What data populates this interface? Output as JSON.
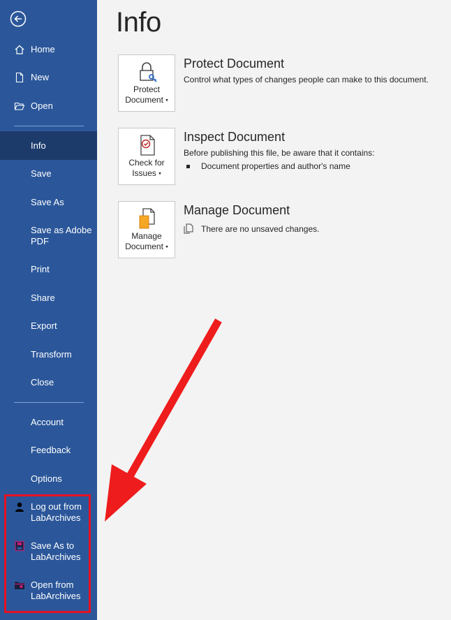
{
  "sidebar": {
    "back_icon": "back-arrow-icon",
    "top_items": [
      {
        "label": "Home",
        "icon": "home-icon"
      },
      {
        "label": "New",
        "icon": "new-document-icon"
      },
      {
        "label": "Open",
        "icon": "open-folder-icon"
      }
    ],
    "middle_items": [
      {
        "label": "Info",
        "active": true
      },
      {
        "label": "Save"
      },
      {
        "label": "Save As"
      },
      {
        "label": "Save as Adobe PDF"
      },
      {
        "label": "Print"
      },
      {
        "label": "Share"
      },
      {
        "label": "Export"
      },
      {
        "label": "Transform"
      },
      {
        "label": "Close"
      }
    ],
    "bottom_items": [
      {
        "label": "Account"
      },
      {
        "label": "Feedback"
      },
      {
        "label": "Options"
      }
    ],
    "labarchives_items": [
      {
        "label": "Log out from LabArchives",
        "icon": "user-icon"
      },
      {
        "label": "Save As to LabArchives",
        "icon": "save-labarchives-icon"
      },
      {
        "label": "Open from LabArchives",
        "icon": "open-labarchives-folder-icon"
      }
    ]
  },
  "main": {
    "title": "Info",
    "sections": [
      {
        "button_label": "Protect Document",
        "button_icon": "lock-key-icon",
        "title": "Protect Document",
        "description": "Control what types of changes people can make to this document."
      },
      {
        "button_label": "Check for Issues",
        "button_icon": "inspect-document-icon",
        "title": "Inspect Document",
        "description": "Before publishing this file, be aware that it contains:",
        "bullets": [
          "Document properties and author's name"
        ]
      },
      {
        "button_label": "Manage Document",
        "button_icon": "manage-document-icon",
        "title": "Manage Document",
        "description": "There are no unsaved changes."
      }
    ]
  },
  "annotation": {
    "box_color": "#e81123",
    "arrow_color": "#ee1c1c"
  },
  "colors": {
    "sidebar": "#2b579a",
    "sidebar_active": "#1c3b6b",
    "background": "#f3f3f3"
  }
}
